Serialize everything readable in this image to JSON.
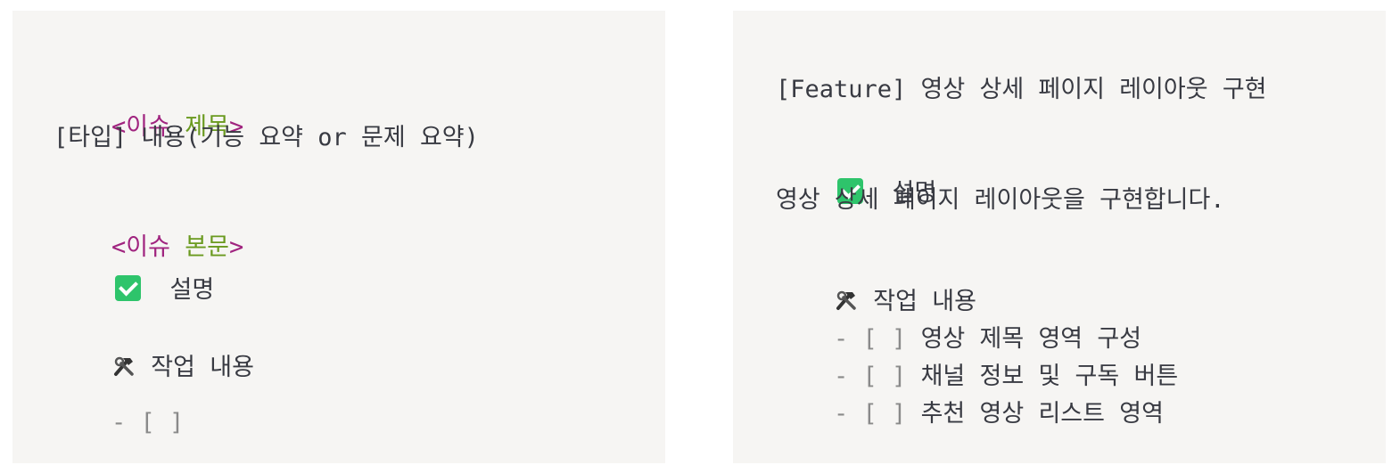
{
  "template": {
    "title_open": "<",
    "title_tag_a": "이슈",
    "title_tag_b": "제목",
    "title_close": ">",
    "title_line": "[타입] 내용(기능 요약 or 문제 요약)",
    "body_open": "<",
    "body_tag_a": "이슈",
    "body_tag_b": "본문",
    "body_close": ">",
    "description_heading": "설명",
    "tasks_heading": "작업 내용",
    "task_item": "- [ ]"
  },
  "example": {
    "title_line": "[Feature] 영상 상세 페이지 레이아웃 구현",
    "description_heading": "설명",
    "description_text": "영상 상세 페이지 레이아웃을 구현합니다.",
    "tasks_heading": "작업 내용",
    "task_prefix": "- [ ]",
    "tasks": [
      "영상 제목 영역 구성",
      "채널 정보 및 구독 버튼",
      "추천 영상 리스트 영역"
    ]
  },
  "colors": {
    "bracket": "#a0247f",
    "tag": "#6a9a1f",
    "check": "#2ec46b",
    "background": "#f6f5f3"
  },
  "icons": {
    "check": "check-box-icon",
    "tools": "hammer-wrench-icon"
  }
}
